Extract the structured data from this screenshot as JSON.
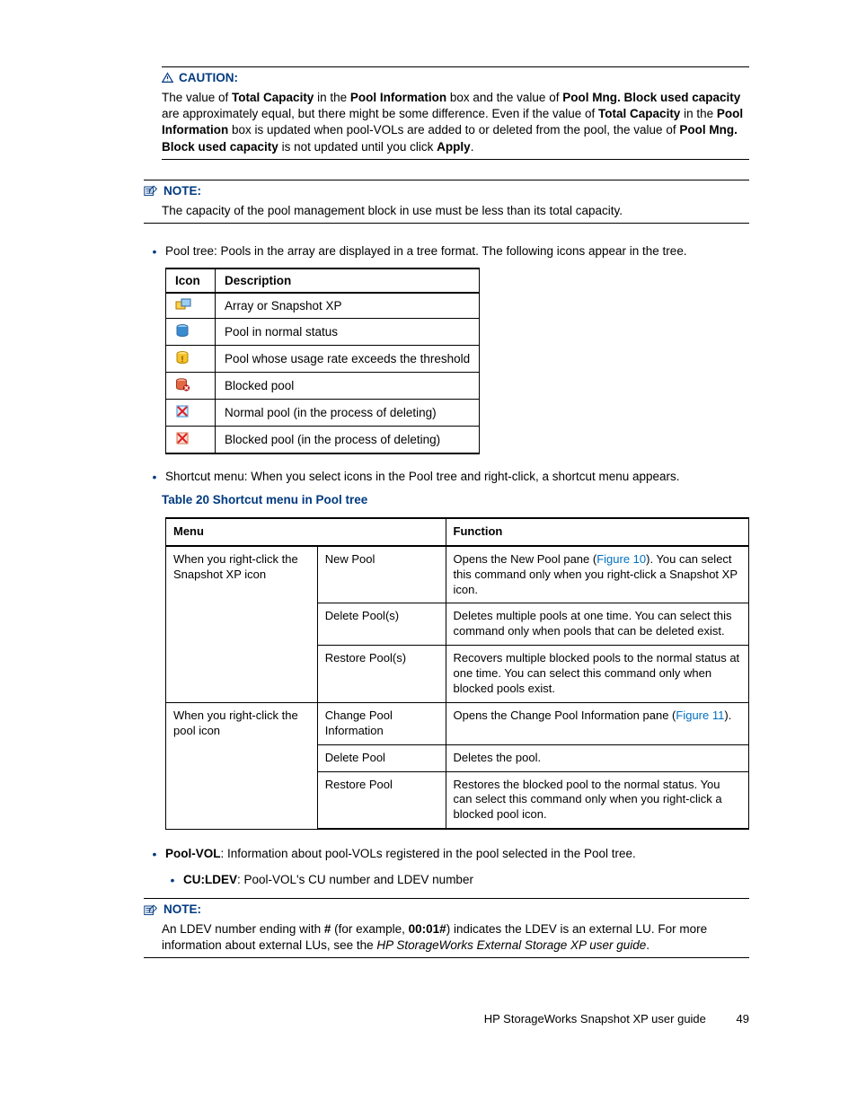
{
  "caution": {
    "label": "CAUTION:",
    "body_html": "The value of <b>Total Capacity</b> in the <b>Pool Information</b> box and the value of <b>Pool Mng. Block used capacity</b> are approximately equal, but there might be some difference.  Even if the value of <b>Total Capacity</b> in the <b>Pool Information</b> box is updated when pool-VOLs are added to or deleted from the pool, the value of <b>Pool Mng. Block used capacity</b> is not updated until you click <b>Apply</b>."
  },
  "note1": {
    "label": "NOTE:",
    "body": "The capacity of the pool management block in use must be less than its total capacity."
  },
  "pool_tree_bullet": "Pool tree: Pools in the array are displayed in a tree format.  The following icons appear in the tree.",
  "icon_table": {
    "head_icon": "Icon",
    "head_desc": "Description",
    "rows": [
      {
        "icon_name": "array-snapshot-xp-icon",
        "desc": "Array or Snapshot XP"
      },
      {
        "icon_name": "pool-normal-icon",
        "desc": "Pool in normal status"
      },
      {
        "icon_name": "pool-threshold-icon",
        "desc": "Pool whose usage rate exceeds the threshold"
      },
      {
        "icon_name": "pool-blocked-icon",
        "desc": "Blocked pool"
      },
      {
        "icon_name": "pool-normal-deleting-icon",
        "desc": "Normal pool (in the process of deleting)"
      },
      {
        "icon_name": "pool-blocked-deleting-icon",
        "desc": "Blocked pool (in the process of deleting)"
      }
    ]
  },
  "shortcut_bullet": "Shortcut menu: When you select icons in the Pool tree and right-click, a shortcut menu appears.",
  "table20_title": "Table 20 Shortcut menu in Pool tree",
  "menu_table": {
    "head_menu": "Menu",
    "head_func": "Function",
    "group1_menu": "When you right-click the Snapshot XP icon",
    "group1": [
      {
        "cmd": "New Pool",
        "func_html": "Opens the New Pool pane (<span class='link'>Figure 10</span>).  You can select this command only when you right-click a Snapshot XP icon."
      },
      {
        "cmd": "Delete Pool(s)",
        "func_html": "Deletes multiple pools at one time.  You can select this command only when pools that can be deleted exist."
      },
      {
        "cmd": "Restore Pool(s)",
        "func_html": "Recovers multiple blocked pools to the normal status at one time.  You can select this command only when blocked pools exist."
      }
    ],
    "group2_menu": "When you right-click the pool icon",
    "group2": [
      {
        "cmd": "Change Pool Information",
        "func_html": "Opens the Change Pool Information pane (<span class='link'>Figure 11</span>)."
      },
      {
        "cmd": "Delete Pool",
        "func_html": "Deletes the pool."
      },
      {
        "cmd": "Restore Pool",
        "func_html": "Restores the blocked pool to the normal status.  You can select this command only when you right-click a blocked pool icon."
      }
    ]
  },
  "poolvol_bullet_html": "<b>Pool-VOL</b>: Information about pool-VOLs registered in the pool selected in the Pool tree.",
  "culdev_bullet_html": "<b>CU:LDEV</b>: Pool-VOL's CU number and LDEV number",
  "note2": {
    "label": "NOTE:",
    "body_html": "An LDEV number ending with <b>#</b> (for example, <b>00:01#</b>) indicates the LDEV is an external LU. For more information about external LUs, see the <i>HP StorageWorks External Storage XP user guide</i>."
  },
  "footer_text": "HP StorageWorks Snapshot XP user guide",
  "page_number": "49"
}
